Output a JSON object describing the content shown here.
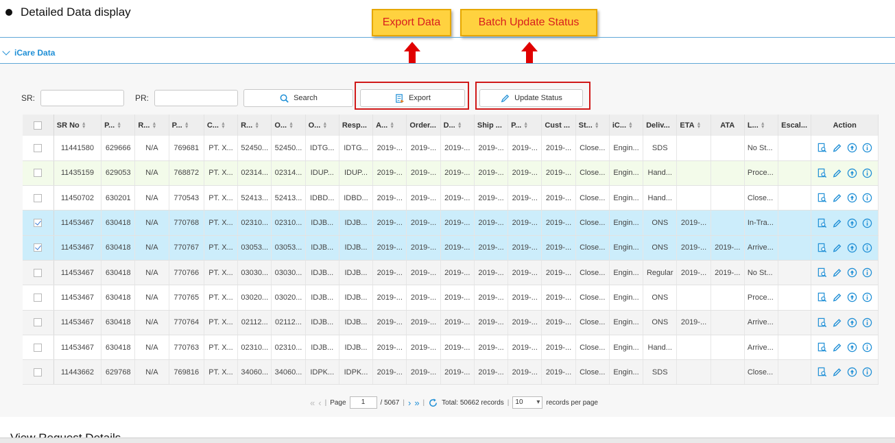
{
  "heading": "Detailed Data display",
  "callouts": {
    "export": "Export Data",
    "batch": "Batch Update Status"
  },
  "panel": {
    "title": "iCare Data"
  },
  "filters": {
    "sr_label": "SR:",
    "sr_value": "",
    "pr_label": "PR:",
    "pr_value": "",
    "search_label": "Search",
    "export_label": "Export",
    "update_label": "Update Status"
  },
  "columns": [
    "SR No",
    "P...",
    "R...",
    "P...",
    "C...",
    "R...",
    "O...",
    "O...",
    "Resp...",
    "A...",
    "Order...",
    "D...",
    "Ship ...",
    "P...",
    "Cust ...",
    "St...",
    "iC...",
    "Deliv...",
    "ETA",
    "ATA",
    "L...",
    "Escal...",
    "Action"
  ],
  "rows": [
    {
      "checked": false,
      "cells": [
        "11441580",
        "629666",
        "N/A",
        "769681",
        "PT. X...",
        "52450...",
        "52450...",
        "IDTG...",
        "IDTG...",
        "2019-...",
        "2019-...",
        "2019-...",
        "2019-...",
        "2019-...",
        "2019-...",
        "Close...",
        "Engin...",
        "SDS",
        "",
        "",
        "No St...",
        ""
      ]
    },
    {
      "checked": false,
      "cells": [
        "11435159",
        "629053",
        "N/A",
        "768872",
        "PT. X...",
        "02314...",
        "02314...",
        "IDUP...",
        "IDUP...",
        "2019-...",
        "2019-...",
        "2019-...",
        "2019-...",
        "2019-...",
        "2019-...",
        "Close...",
        "Engin...",
        "Hand...",
        "",
        "",
        "Proce...",
        ""
      ]
    },
    {
      "checked": false,
      "cells": [
        "11450702",
        "630201",
        "N/A",
        "770543",
        "PT. X...",
        "52413...",
        "52413...",
        "IDBD...",
        "IDBD...",
        "2019-...",
        "2019-...",
        "2019-...",
        "2019-...",
        "2019-...",
        "2019-...",
        "Close...",
        "Engin...",
        "Hand...",
        "",
        "",
        "Close...",
        ""
      ]
    },
    {
      "checked": true,
      "cells": [
        "11453467",
        "630418",
        "N/A",
        "770768",
        "PT. X...",
        "02310...",
        "02310...",
        "IDJB...",
        "IDJB...",
        "2019-...",
        "2019-...",
        "2019-...",
        "2019-...",
        "2019-...",
        "2019-...",
        "Close...",
        "Engin...",
        "ONS",
        "2019-...",
        "",
        "In-Tra...",
        ""
      ]
    },
    {
      "checked": true,
      "cells": [
        "11453467",
        "630418",
        "N/A",
        "770767",
        "PT. X...",
        "03053...",
        "03053...",
        "IDJB...",
        "IDJB...",
        "2019-...",
        "2019-...",
        "2019-...",
        "2019-...",
        "2019-...",
        "2019-...",
        "Close...",
        "Engin...",
        "ONS",
        "2019-...",
        "2019-...",
        "Arrive...",
        ""
      ]
    },
    {
      "checked": false,
      "cells": [
        "11453467",
        "630418",
        "N/A",
        "770766",
        "PT. X...",
        "03030...",
        "03030...",
        "IDJB...",
        "IDJB...",
        "2019-...",
        "2019-...",
        "2019-...",
        "2019-...",
        "2019-...",
        "2019-...",
        "Close...",
        "Engin...",
        "Regular",
        "2019-...",
        "2019-...",
        "No St...",
        ""
      ]
    },
    {
      "checked": false,
      "cells": [
        "11453467",
        "630418",
        "N/A",
        "770765",
        "PT. X...",
        "03020...",
        "03020...",
        "IDJB...",
        "IDJB...",
        "2019-...",
        "2019-...",
        "2019-...",
        "2019-...",
        "2019-...",
        "2019-...",
        "Close...",
        "Engin...",
        "ONS",
        "",
        "",
        "Proce...",
        ""
      ]
    },
    {
      "checked": false,
      "cells": [
        "11453467",
        "630418",
        "N/A",
        "770764",
        "PT. X...",
        "02112...",
        "02112...",
        "IDJB...",
        "IDJB...",
        "2019-...",
        "2019-...",
        "2019-...",
        "2019-...",
        "2019-...",
        "2019-...",
        "Close...",
        "Engin...",
        "ONS",
        "2019-...",
        "",
        "Arrive...",
        ""
      ]
    },
    {
      "checked": false,
      "cells": [
        "11453467",
        "630418",
        "N/A",
        "770763",
        "PT. X...",
        "02310...",
        "02310...",
        "IDJB...",
        "IDJB...",
        "2019-...",
        "2019-...",
        "2019-...",
        "2019-...",
        "2019-...",
        "2019-...",
        "Close...",
        "Engin...",
        "Hand...",
        "",
        "",
        "Arrive...",
        ""
      ]
    },
    {
      "checked": false,
      "cells": [
        "11443662",
        "629768",
        "N/A",
        "769816",
        "PT. X...",
        "34060...",
        "34060...",
        "IDPK...",
        "IDPK...",
        "2019-...",
        "2019-...",
        "2019-...",
        "2019-...",
        "2019-...",
        "2019-...",
        "Close...",
        "Engin...",
        "SDS",
        "",
        "",
        "Close...",
        ""
      ]
    }
  ],
  "pager": {
    "page_label": "Page",
    "page_value": "1",
    "total_pages": "/ 5067",
    "total_label": "Total: 50662 records",
    "page_size": "10",
    "per_page_label": "records per page"
  },
  "bottom_text": "View Request Details",
  "icons": [
    "view-icon",
    "edit-icon",
    "upload-icon",
    "info-icon"
  ]
}
